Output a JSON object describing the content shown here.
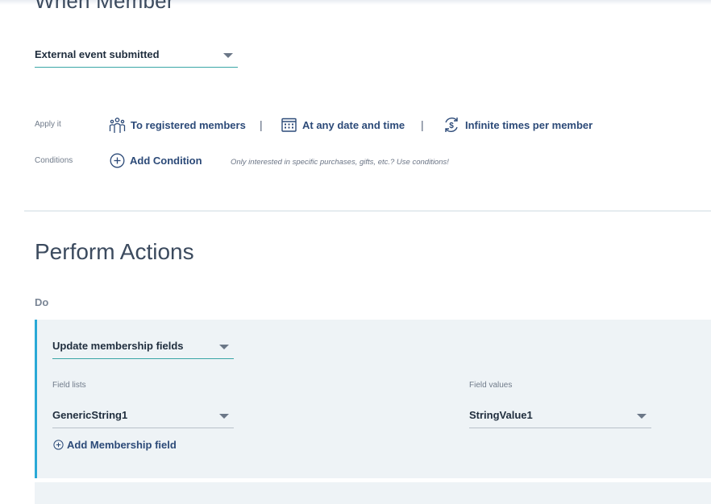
{
  "when_section": {
    "title": "When Member",
    "trigger_dropdown": {
      "value": "External event submitted"
    },
    "apply_label": "Apply it",
    "apply_options": {
      "audience": "To registered members",
      "schedule": "At any date and time",
      "frequency": "Infinite times per member",
      "separator": "|"
    },
    "conditions_label": "Conditions",
    "add_condition_label": "Add Condition",
    "conditions_hint": "Only interested in specific purchases, gifts, etc.? Use conditions!"
  },
  "perform_section": {
    "title": "Perform Actions",
    "do_label": "Do",
    "action": {
      "type_dropdown": {
        "value": "Update membership fields"
      },
      "field_lists_label": "Field lists",
      "field_list_value": "GenericString1",
      "field_values_label": "Field values",
      "field_value_value": "StringValue1",
      "add_field_label": "Add Membership field"
    }
  },
  "colors": {
    "accent": "#29a9d6",
    "link": "#2c4a78",
    "underline": "#3aa6a6",
    "card_bg": "#eef3f6"
  },
  "icons": [
    "people-icon",
    "calendar-icon",
    "repeat-dollar-icon",
    "plus-circle-icon",
    "chevron-down-icon"
  ]
}
